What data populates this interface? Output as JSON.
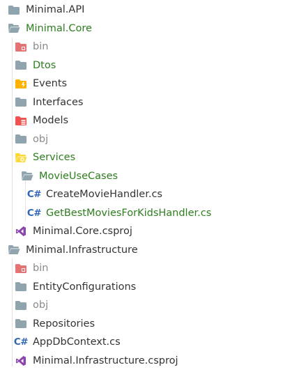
{
  "tree": {
    "items": [
      {
        "label": "Minimal.API",
        "icon": "folder-closed-icon"
      },
      {
        "label": "Minimal.Core",
        "icon": "folder-open-icon"
      },
      {
        "label": "bin",
        "icon": "folder-bin-icon"
      },
      {
        "label": "Dtos",
        "icon": "folder-closed-icon"
      },
      {
        "label": "Events",
        "icon": "folder-events-icon"
      },
      {
        "label": "Interfaces",
        "icon": "folder-closed-icon"
      },
      {
        "label": "Models",
        "icon": "folder-models-icon"
      },
      {
        "label": "obj",
        "icon": "folder-closed-icon"
      },
      {
        "label": "Services",
        "icon": "folder-services-icon"
      },
      {
        "label": "MovieUseCases",
        "icon": "folder-open-icon"
      },
      {
        "label": "CreateMovieHandler.cs",
        "icon": "csharp-file-icon",
        "badge": "C#"
      },
      {
        "label": "GetBestMoviesForKidsHandler.cs",
        "icon": "csharp-file-icon",
        "badge": "C#"
      },
      {
        "label": "Minimal.Core.csproj",
        "icon": "visual-studio-icon"
      },
      {
        "label": "Minimal.Infrastructure",
        "icon": "folder-open-icon"
      },
      {
        "label": "bin",
        "icon": "folder-bin-icon"
      },
      {
        "label": "EntityConfigurations",
        "icon": "folder-closed-icon"
      },
      {
        "label": "obj",
        "icon": "folder-closed-icon"
      },
      {
        "label": "Repositories",
        "icon": "folder-closed-icon"
      },
      {
        "label": "AppDbContext.cs",
        "icon": "csharp-file-icon",
        "badge": "C#"
      },
      {
        "label": "Minimal.Infrastructure.csproj",
        "icon": "visual-studio-icon"
      }
    ]
  },
  "colors": {
    "folder": "#90a4ae",
    "bin_folder": "#e57373",
    "models_folder": "#ef5350",
    "events_folder": "#ffb300",
    "services_folder": "#fdd835",
    "csharp": "#3066b7",
    "visual_studio": "#8e44ad",
    "git_modified_text": "#2e7d1f",
    "ignored_text": "#8a8a8a"
  }
}
